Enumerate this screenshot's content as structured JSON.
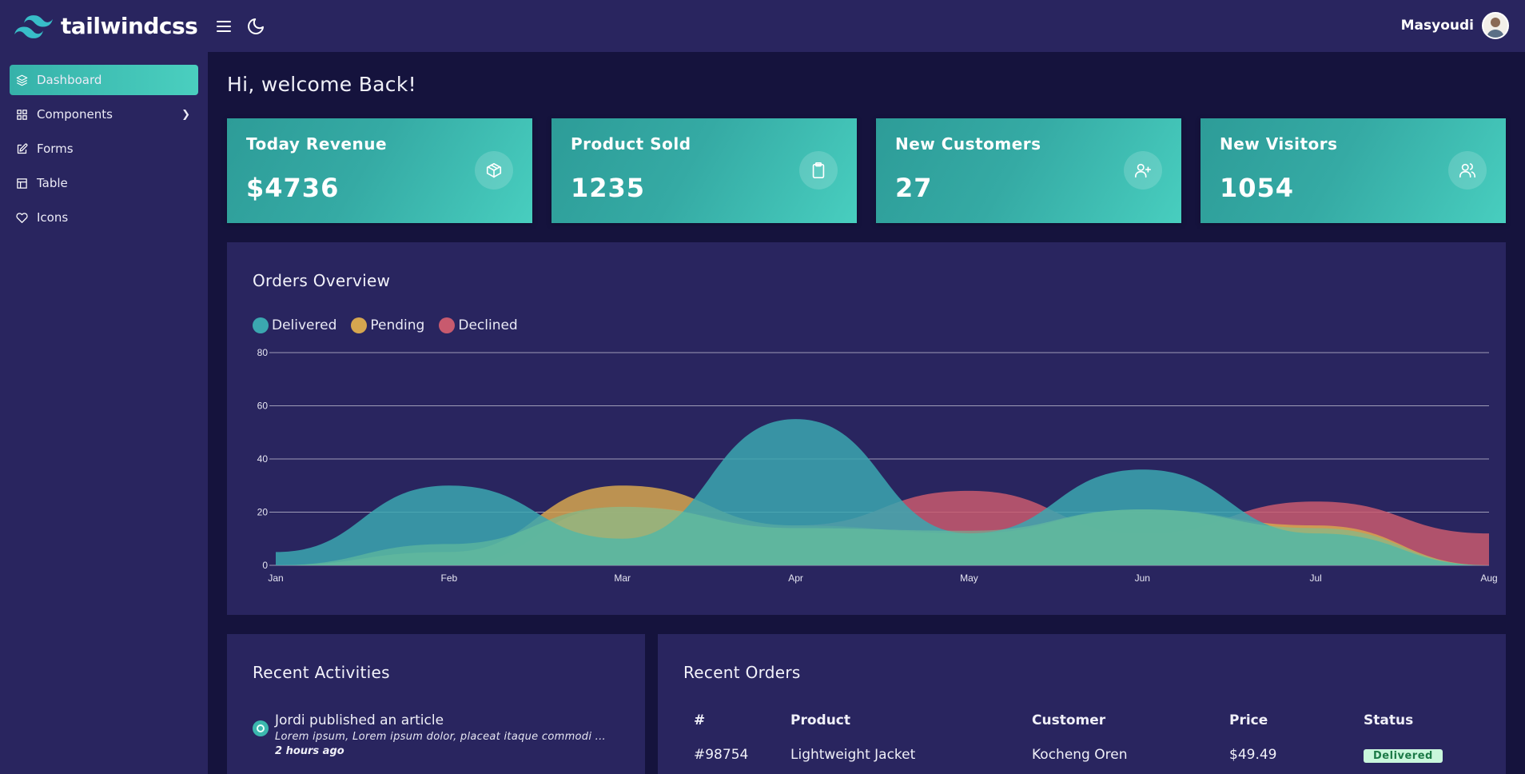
{
  "app": {
    "brand": "tailwindcss"
  },
  "header": {
    "user_name": "Masyoudi"
  },
  "sidebar": {
    "items": [
      {
        "label": "Dashboard",
        "icon": "layers-icon",
        "active": true
      },
      {
        "label": "Components",
        "icon": "grid-icon",
        "chevron": "❯"
      },
      {
        "label": "Forms",
        "icon": "edit-icon"
      },
      {
        "label": "Table",
        "icon": "table-icon"
      },
      {
        "label": "Icons",
        "icon": "heart-icon"
      }
    ]
  },
  "main": {
    "greeting": "Hi, welcome Back!",
    "stats": [
      {
        "title": "Today Revenue",
        "value": "$4736",
        "icon": "box-icon"
      },
      {
        "title": "Product Sold",
        "value": "1235",
        "icon": "clipboard-icon"
      },
      {
        "title": "New Customers",
        "value": "27",
        "icon": "user-plus-icon"
      },
      {
        "title": "New Visitors",
        "value": "1054",
        "icon": "users-icon"
      }
    ]
  },
  "orders_overview": {
    "title": "Orders Overview"
  },
  "chart_data": {
    "type": "area",
    "title": "Orders Overview",
    "categories": [
      "Jan",
      "Feb",
      "Mar",
      "Apr",
      "May",
      "Jun",
      "Jul",
      "Aug"
    ],
    "ylim": [
      0,
      80
    ],
    "yticks": [
      0,
      20,
      40,
      60,
      80
    ],
    "grid": true,
    "legend_position": "top-left",
    "series": [
      {
        "name": "Delivered",
        "color": "#3ba7b0",
        "values": [
          5,
          30,
          10,
          55,
          12,
          36,
          12,
          0
        ]
      },
      {
        "name": "Pending",
        "color": "#d6a64f",
        "values": [
          0,
          5,
          30,
          15,
          12,
          21,
          15,
          0
        ]
      },
      {
        "name": "Declined",
        "color": "#c85a6e",
        "values": [
          0,
          0,
          22,
          15,
          28,
          12,
          24,
          12
        ]
      }
    ],
    "overlay_color": "#6cc49a",
    "overlay_values": [
      0,
      8,
      22,
      14,
      13,
      21,
      14,
      0
    ]
  },
  "activities": {
    "title": "Recent Activities",
    "items": [
      {
        "title": "Jordi published an article",
        "desc": "Lorem ipsum, Lorem ipsum dolor, placeat itaque commodi ...",
        "time": "2 hours ago"
      }
    ]
  },
  "orders": {
    "title": "Recent Orders",
    "columns": [
      "#",
      "Product",
      "Customer",
      "Price",
      "Status"
    ],
    "rows": [
      {
        "id": "#98754",
        "product": "Lightweight Jacket",
        "customer": "Kocheng Oren",
        "price": "$49.49",
        "status": "Delivered"
      }
    ]
  },
  "colors": {
    "accent": "#3bb7ae",
    "background": "#15133d",
    "panel": "#29255f"
  }
}
